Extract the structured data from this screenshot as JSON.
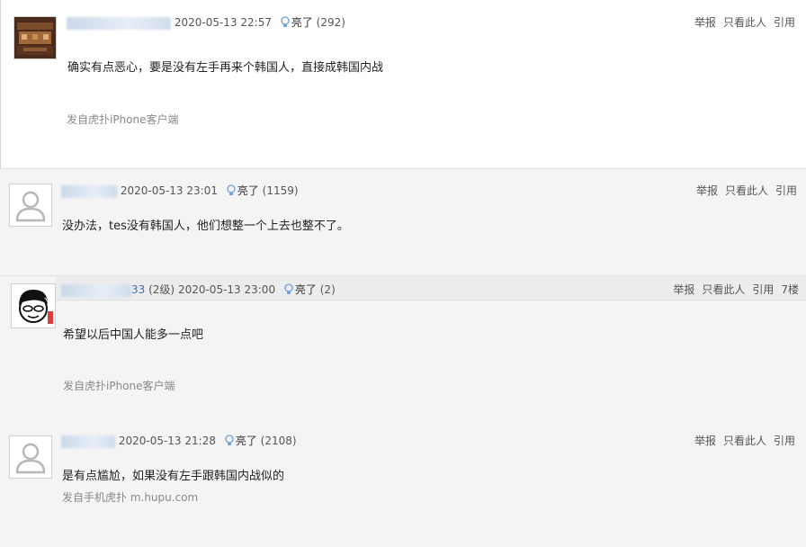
{
  "posts": [
    {
      "user_tail": "",
      "level": "",
      "time": "2020-05-13 22:57",
      "light_label": "亮了",
      "light_count": "(292)",
      "report": "举报",
      "only_this": "只看此人",
      "quote": "引用",
      "floor": "",
      "content": "确实有点恶心，要是没有左手再来个韩国人，直接成韩国内战",
      "source": "发自虎扑iPhone客户端"
    },
    {
      "user_tail": "",
      "level": "",
      "time": "2020-05-13 23:01",
      "light_label": "亮了",
      "light_count": "(1159)",
      "report": "举报",
      "only_this": "只看此人",
      "quote": "引用",
      "floor": "",
      "content": "没办法，tes没有韩国人，他们想整一个上去也整不了。",
      "source": ""
    },
    {
      "user_tail": "33",
      "level": "(2级)",
      "time": "2020-05-13 23:00",
      "light_label": "亮了",
      "light_count": "(2)",
      "report": "举报",
      "only_this": "只看此人",
      "quote": "引用",
      "floor": "7楼",
      "content": "希望以后中国人能多一点吧",
      "source": "发自虎扑iPhone客户端"
    },
    {
      "user_tail": "",
      "level": "",
      "time": "2020-05-13 21:28",
      "light_label": "亮了",
      "light_count": "(2108)",
      "report": "举报",
      "only_this": "只看此人",
      "quote": "引用",
      "floor": "",
      "content": "是有点尴尬，如果没有左手跟韩国内战似的",
      "source": "发自手机虎扑 m.hupu.com"
    }
  ],
  "icons": {
    "bulb": "lightbulb-icon",
    "default_avatar": "default-avatar-icon",
    "painting_avatar": "painting-avatar-icon",
    "cartoon_avatar": "cartoon-face-avatar-icon"
  },
  "colors": {
    "post_bg_alt": "#f4f4f4",
    "username_link": "#3b6eb0",
    "bulb_blue": "#6aa0d8",
    "separator": "#dde3ea"
  }
}
